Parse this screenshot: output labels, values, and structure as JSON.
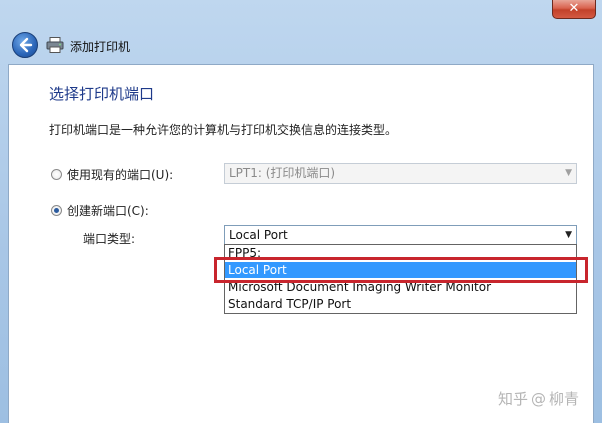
{
  "window": {
    "close_glyph": "✕"
  },
  "nav": {
    "title": "添加打印机"
  },
  "page": {
    "heading": "选择打印机端口",
    "description": "打印机端口是一种允许您的计算机与打印机交换信息的连接类型。"
  },
  "existing_port": {
    "label": "使用现有的端口(U):",
    "value": "LPT1: (打印机端口)",
    "selected": false
  },
  "new_port": {
    "label": "创建新端口(C):",
    "selected": true,
    "type_label": "端口类型:",
    "value": "Local Port",
    "options": [
      "FPP5:",
      "Local Port",
      "Microsoft Document Imaging Writer Monitor",
      "Standard TCP/IP Port"
    ],
    "highlighted": "Local Port"
  },
  "watermark": {
    "text_left": "知乎",
    "text_right": "柳青"
  },
  "colors": {
    "highlight": "#3399ff",
    "annotation": "#c8252d",
    "heading": "#1e3a8a"
  }
}
